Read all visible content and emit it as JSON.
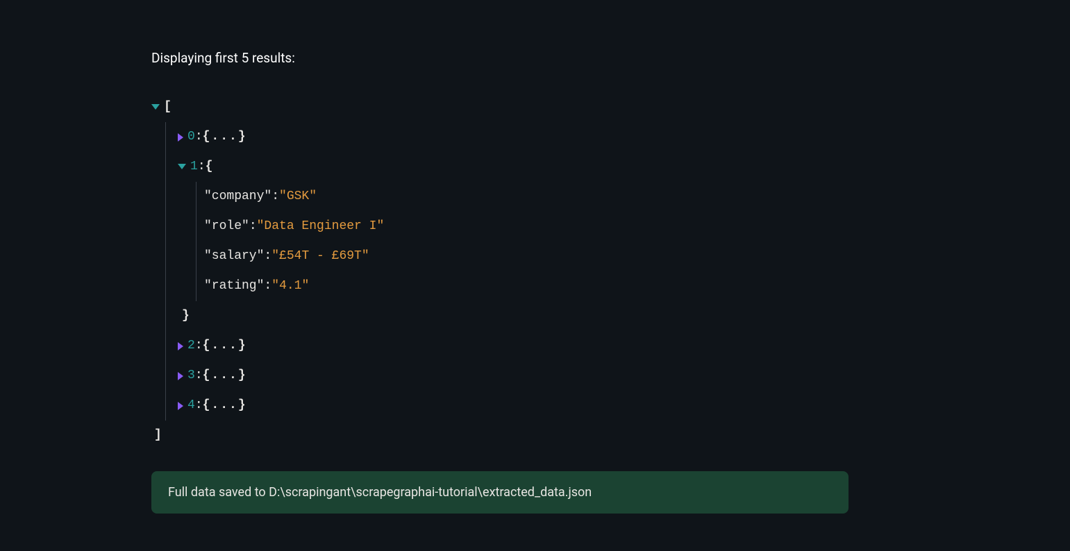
{
  "header": {
    "title": "Displaying first 5 results:"
  },
  "json": {
    "open_bracket": "[",
    "close_bracket": "]",
    "items": [
      {
        "index": "0",
        "collapsed": true
      },
      {
        "index": "1",
        "collapsed": false,
        "props": {
          "company": {
            "key": "\"company\"",
            "value": "\"GSK\""
          },
          "role": {
            "key": "\"role\"",
            "value": "\"Data Engineer I\""
          },
          "salary": {
            "key": "\"salary\"",
            "value": "\"£54T - £69T\""
          },
          "rating": {
            "key": "\"rating\"",
            "value": "\"4.1\""
          }
        }
      },
      {
        "index": "2",
        "collapsed": true
      },
      {
        "index": "3",
        "collapsed": true
      },
      {
        "index": "4",
        "collapsed": true
      }
    ],
    "colon": " : ",
    "open_brace": "{",
    "close_brace": "}",
    "ellipsis_brace": "{...}"
  },
  "status": {
    "message": "Full data saved to D:\\scrapingant\\scrapegraphai-tutorial\\extracted_data.json"
  }
}
